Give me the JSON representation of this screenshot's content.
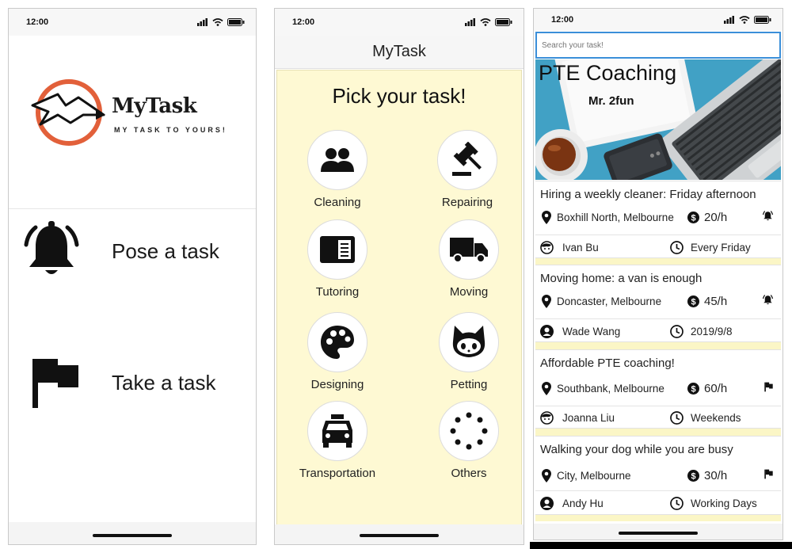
{
  "status_bar": {
    "time": "12:00"
  },
  "screen_welcome": {
    "brand_name": "MyTask",
    "brand_tagline": "MY TASK TO YOURS!",
    "actions": [
      {
        "label": "Pose a task",
        "icon": "bell-icon"
      },
      {
        "label": "Take a task",
        "icon": "flag-icon"
      }
    ]
  },
  "screen_categories": {
    "nav_title": "MyTask",
    "heading": "Pick your task!",
    "categories": [
      {
        "label": "Cleaning",
        "icon": "people-icon"
      },
      {
        "label": "Repairing",
        "icon": "gavel-icon"
      },
      {
        "label": "Tutoring",
        "icon": "book-icon"
      },
      {
        "label": "Moving",
        "icon": "truck-icon"
      },
      {
        "label": "Designing",
        "icon": "palette-icon"
      },
      {
        "label": "Petting",
        "icon": "cat-icon"
      },
      {
        "label": "Transportation",
        "icon": "taxi-icon"
      },
      {
        "label": "Others",
        "icon": "dots-icon"
      }
    ]
  },
  "screen_tasks": {
    "search_placeholder": "Search your task!",
    "hero_title": "PTE Coaching",
    "hero_subtitle": "Mr. 2fun",
    "tasks": [
      {
        "title": "Hiring a weekly cleaner: Friday afternoon",
        "location": "Boxhill North, Melbourne",
        "price": "20/h",
        "poster": "Ivan Bu",
        "schedule": "Every Friday",
        "status_icon": "bell-icon",
        "avatar_icon": "face-icon"
      },
      {
        "title": "Moving home: a van is enough",
        "location": "Doncaster, Melbourne",
        "price": "45/h",
        "poster": "Wade Wang",
        "schedule": "2019/9/8",
        "status_icon": "bell-icon",
        "avatar_icon": "user-circle-icon"
      },
      {
        "title": "Affordable PTE coaching!",
        "location": "Southbank, Melbourne",
        "price": "60/h",
        "poster": "Joanna Liu",
        "schedule": "Weekends",
        "status_icon": "flag-icon",
        "avatar_icon": "face-icon"
      },
      {
        "title": "Walking your dog while you are busy",
        "location": "City, Melbourne",
        "price": "30/h",
        "poster": "Andy Hu",
        "schedule": "Working Days",
        "status_icon": "flag-icon",
        "avatar_icon": "user-circle-icon"
      }
    ]
  },
  "colors": {
    "accent_orange": "#e2603a",
    "panel_yellow": "#fef9d3",
    "hero_blue": "#41a1c5",
    "search_border": "#3b8fd9"
  }
}
